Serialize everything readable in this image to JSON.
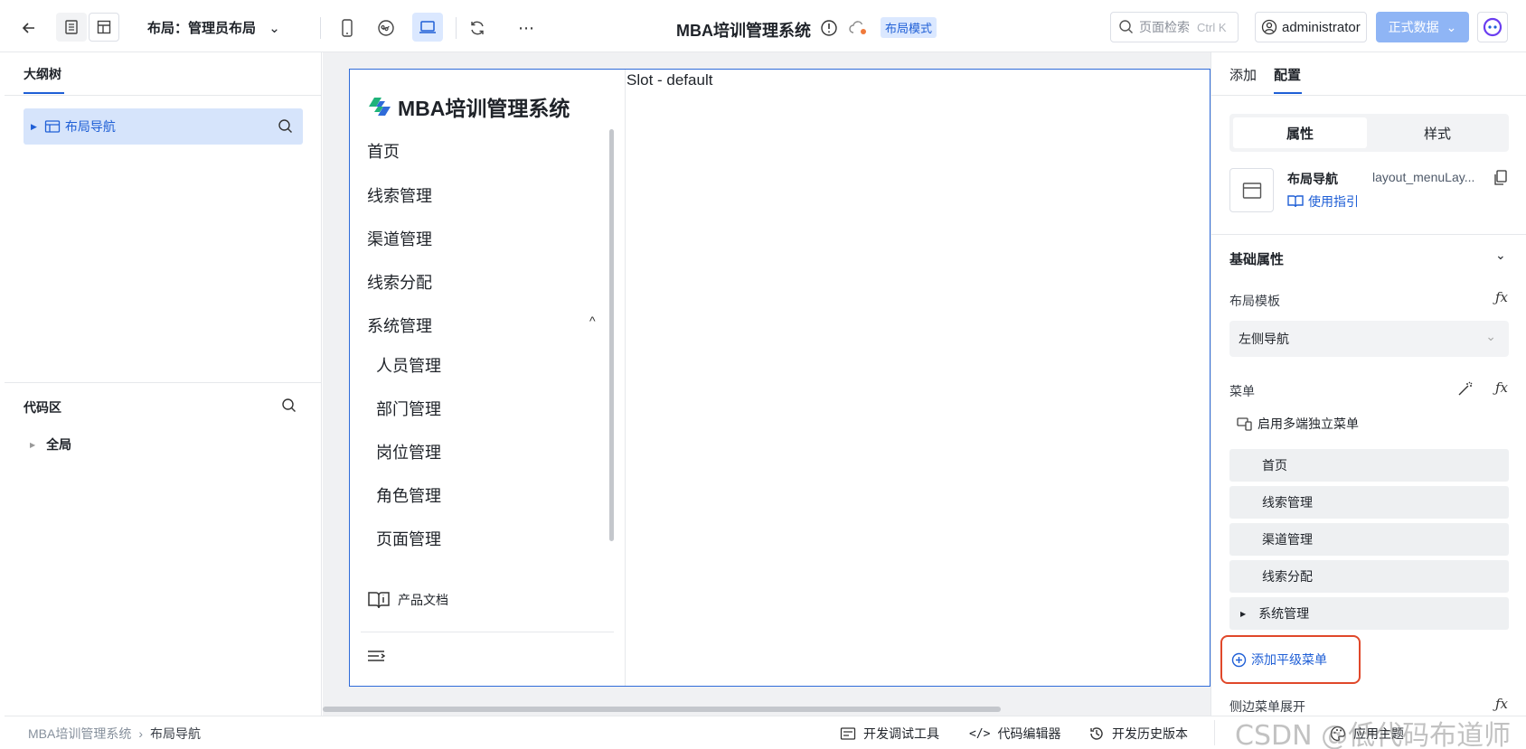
{
  "header": {
    "layout_label": "布局：管理员布局",
    "app_title": "MBA培训管理系统",
    "mode_badge": "布局模式",
    "search_placeholder": "页面检索",
    "search_shortcut": "Ctrl K",
    "username": "administrator",
    "data_env": "正式数据"
  },
  "left_panel": {
    "outline_tab": "大纲树",
    "outline_item": "布局导航",
    "code_title": "代码区",
    "code_item": "全局"
  },
  "canvas": {
    "slot_label": "Slot - default",
    "app_name": "MBA培训管理系统",
    "nav": [
      "首页",
      "线索管理",
      "渠道管理",
      "线索分配",
      "系统管理"
    ],
    "sub_nav": [
      "人员管理",
      "部门管理",
      "岗位管理",
      "角色管理",
      "页面管理"
    ],
    "doc_link": "产品文档"
  },
  "right_panel": {
    "tabs": [
      "添加",
      "配置"
    ],
    "segments": [
      "属性",
      "样式"
    ],
    "component_name": "布局导航",
    "component_id": "layout_menuLay...",
    "guide_link": "使用指引",
    "basic_section": "基础属性",
    "layout_template_label": "布局模板",
    "layout_template_value": "左侧导航",
    "menu_label": "菜单",
    "multi_menu": "启用多端独立菜单",
    "menu_items": [
      "首页",
      "线索管理",
      "渠道管理",
      "线索分配",
      "系统管理"
    ],
    "add_menu": "添加平级菜单",
    "side_expand": "侧边菜单展开"
  },
  "bottom_bar": {
    "breadcrumb": [
      "MBA培训管理系统",
      "布局导航"
    ],
    "dev_tools": "开发调试工具",
    "code_editor": "代码编辑器",
    "history": "开发历史版本",
    "theme": "应用主题"
  },
  "watermark": "CSDN @低代码布道师",
  "colors": {
    "accent": "#1f5fd6",
    "selected_bg": "#d6e4fb",
    "highlight": "#e0482a",
    "cta": "#8fb5f5"
  }
}
